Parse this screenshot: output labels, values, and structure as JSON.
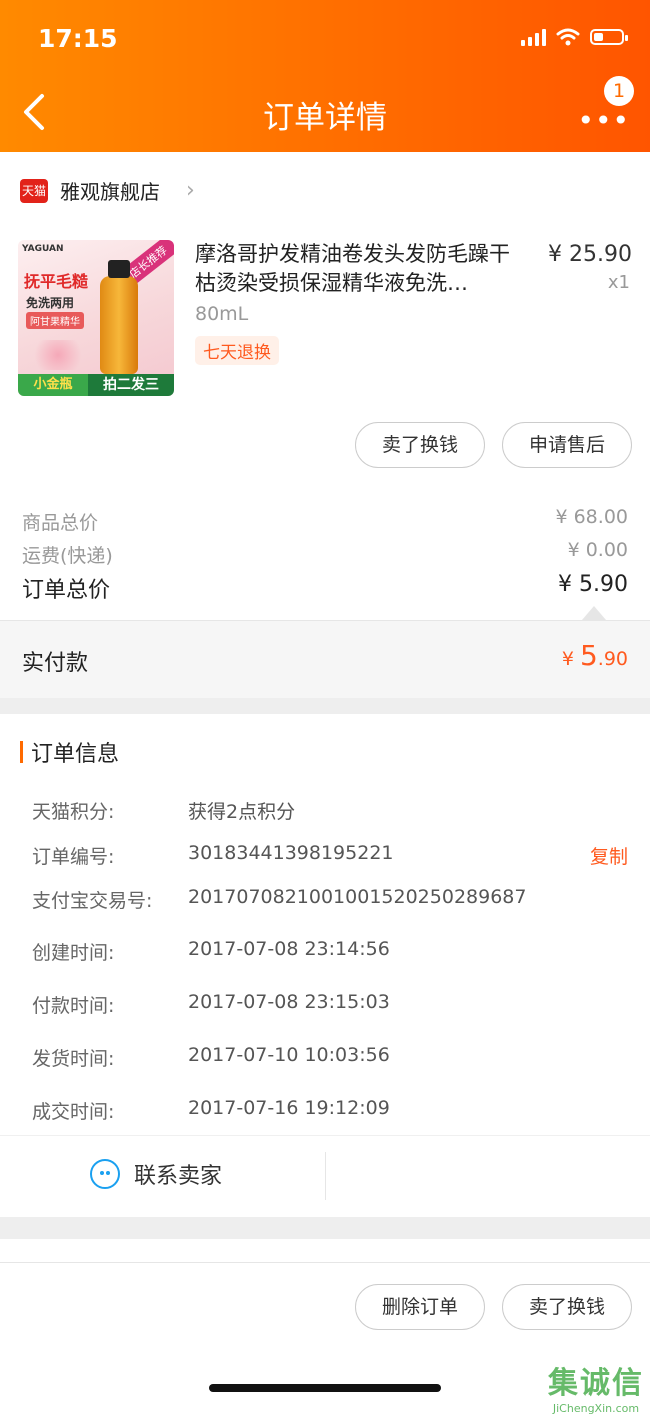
{
  "status_bar": {
    "time": "17:15"
  },
  "header": {
    "title": "订单详情",
    "badge_count": "1"
  },
  "store": {
    "logo_text": "天猫",
    "name": "雅观旗舰店"
  },
  "product": {
    "title": "摩洛哥护发精油卷发头发防毛躁干枯烫染受损保湿精华液免洗…",
    "price": "¥ 25.90",
    "quantity": "x1",
    "spec": "80mL",
    "tag": "七天退换",
    "image_texts": {
      "brand": "YAGUAN",
      "corner": "店长推荐",
      "line1": "抚平毛糙",
      "line2": "免洗两用",
      "line3": "阿甘果精华",
      "bottom_left": "小金瓶",
      "bottom_right": "拍二发三"
    },
    "buttons": {
      "sell": "卖了换钱",
      "after_sale": "申请售后"
    }
  },
  "summary": {
    "goods_total_label": "商品总价",
    "goods_total_value": "¥ 68.00",
    "shipping_label": "运费(快递)",
    "shipping_value": "¥ 0.00",
    "order_total_label": "订单总价",
    "order_total_value": "¥ 5.90",
    "paid_label": "实付款",
    "paid_currency": "¥ ",
    "paid_int": "5",
    "paid_dec": ".90"
  },
  "order_info": {
    "title": "订单信息",
    "rows": [
      {
        "label": "天猫积分:",
        "value": "获得2点积分"
      },
      {
        "label": "订单编号:",
        "value": "301834413981952​21"
      },
      {
        "label": "支付宝交易号:",
        "value": "2017070821001001520250289687"
      },
      {
        "label": "创建时间:",
        "value": "2017-07-08 23:14:56"
      },
      {
        "label": "付款时间:",
        "value": "2017-07-08 23:15:03"
      },
      {
        "label": "发货时间:",
        "value": "2017-07-10 10:03:56"
      },
      {
        "label": "成交时间:",
        "value": "2017-07-16 19:12:09"
      }
    ],
    "copy_label": "复制"
  },
  "contact": {
    "label": "联系卖家"
  },
  "bottom_actions": {
    "delete": "删除订单",
    "sell": "卖了换钱"
  },
  "watermark": {
    "main": "集诚信",
    "sub": "JiChengXin.com"
  },
  "colors": {
    "accent": "#ff6a00",
    "price_red": "#ff5a1f",
    "link_blue": "#1aa0f0"
  }
}
